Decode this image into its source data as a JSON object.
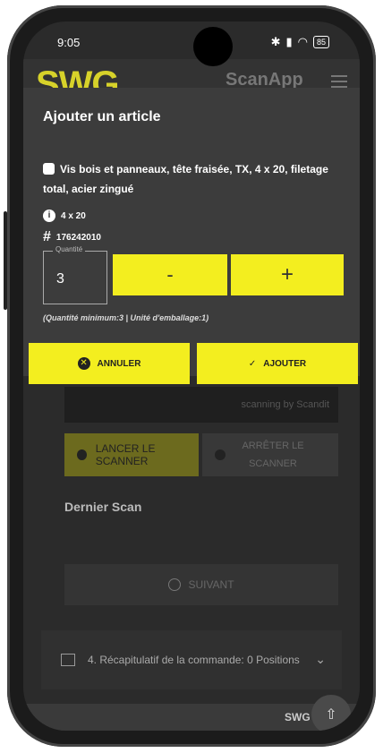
{
  "status": {
    "time": "9:05",
    "battery": "85"
  },
  "app": {
    "logo": "SWG",
    "name": "ScanApp"
  },
  "dialog": {
    "title": "Ajouter un article",
    "description": "Vis bois et panneaux, tête fraisée, TX, 4 x 20, filetage total, acier zingué",
    "size": "4 x 20",
    "article_no": "176242010",
    "quantity_label": "Quantité",
    "quantity_value": "3",
    "minus_label": "-",
    "plus_label": "+",
    "note": "(Quantité minimum:3 | Unité d'emballage:1)",
    "cancel_label": "ANNULER",
    "add_label": "AJOUTER"
  },
  "background": {
    "scan_hint": "scanning by Scandit",
    "start_scanner": "LANCER LE SCANNER",
    "stop_scanner": "ARRÊTER LE SCANNER",
    "last_scan": "Dernier Scan",
    "next": "SUIVANT",
    "summary": "4. Récapitulatif de la commande: 0 Positions",
    "footer_logo": "SWG"
  }
}
